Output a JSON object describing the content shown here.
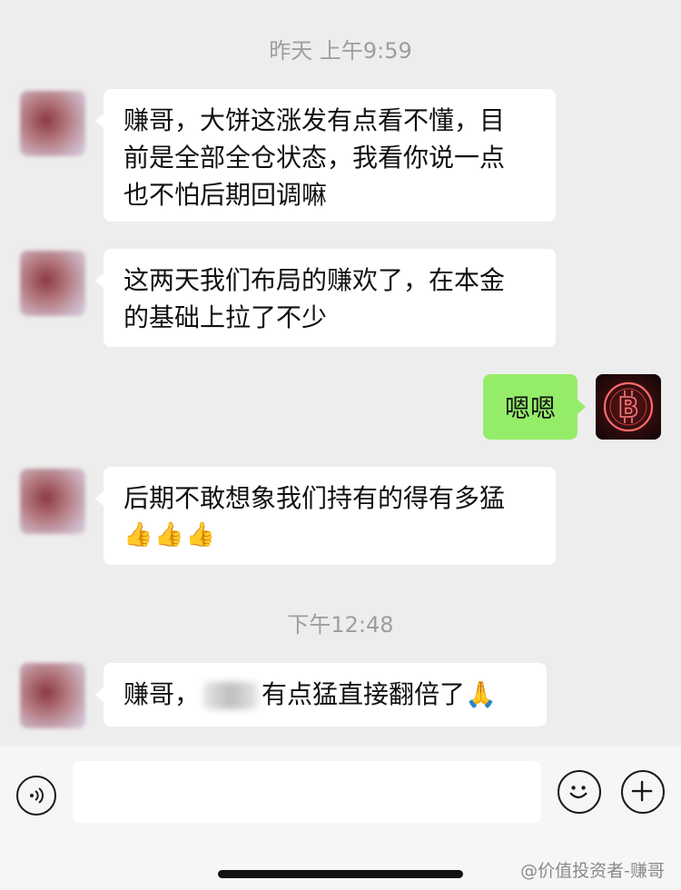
{
  "timestamps": [
    "昨天 上午9:59",
    "下午12:48"
  ],
  "messages": [
    {
      "side": "left",
      "lines": [
        "赚哥，大饼这涨发有点看不懂，目",
        "前是全部全仓状态，我看你说一点",
        "也不怕后期回调嘛"
      ]
    },
    {
      "side": "left",
      "lines": [
        "这两天我们布局的赚欢了，在本金",
        "的基础上拉了不少"
      ]
    },
    {
      "side": "right",
      "text": "嗯嗯"
    },
    {
      "side": "left",
      "lines": [
        "后期不敢想象我们持有的得有多猛"
      ],
      "emoji": "👍👍👍"
    },
    {
      "side": "left",
      "prefix": "赚哥，",
      "suffix": "有点猛直接翻倍了",
      "emoji": "🙏"
    }
  ],
  "input_bar": {
    "voice_icon": "voice-icon",
    "emoji_icon": "emoji-face-icon",
    "plus_icon": "plus-icon",
    "placeholder": ""
  },
  "self_avatar_icon": "bitcoin-logo-icon",
  "watermark": "@价值投资者-赚哥",
  "colors": {
    "background": "#ededed",
    "self_bubble": "#95ec69",
    "other_bubble": "#ffffff",
    "timestamp": "#9e9e9e"
  }
}
